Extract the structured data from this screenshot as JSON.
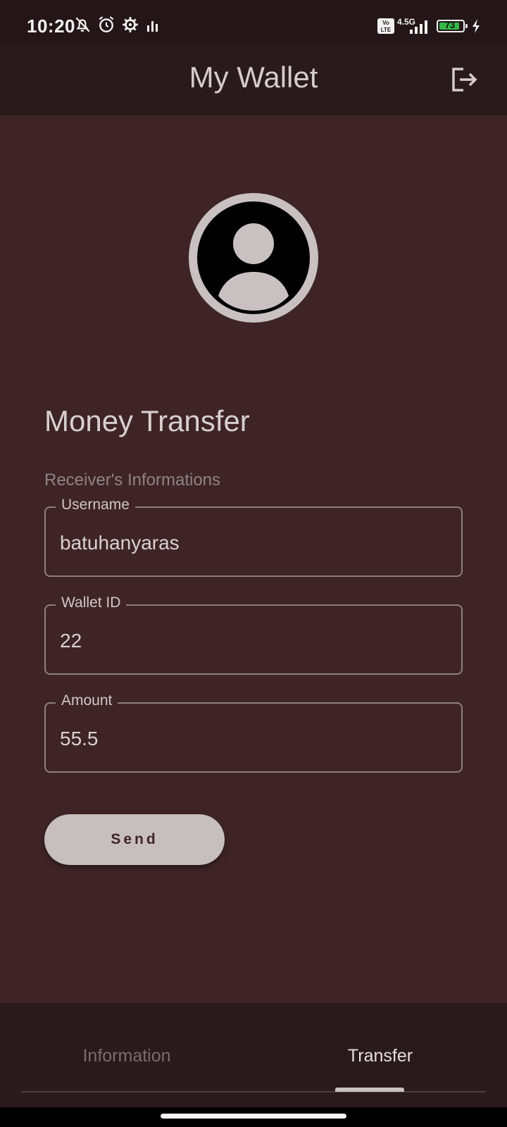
{
  "status_bar": {
    "time": "10:20",
    "icons": [
      "bell-off-icon",
      "alarm-icon",
      "gear-icon",
      "bars-icon",
      "volte-icon",
      "signal-icon",
      "battery-icon",
      "charging-icon"
    ],
    "network": "4.5G",
    "battery_percent": "73",
    "battery_color": "#35b84a"
  },
  "app_bar": {
    "title": "My Wallet",
    "action_icon": "logout-icon"
  },
  "avatar": {
    "icon": "person-icon"
  },
  "form": {
    "title": "Money Transfer",
    "subtitle": "Receiver's Informations",
    "fields": [
      {
        "label": "Username",
        "value": "batuhanyaras"
      },
      {
        "label": "Wallet ID",
        "value": "22"
      },
      {
        "label": "Amount",
        "value": "55.5"
      }
    ],
    "send_label": "Send"
  },
  "bottom_nav": {
    "tabs": [
      {
        "label": "Information",
        "active": false
      },
      {
        "label": "Transfer",
        "active": true
      }
    ]
  },
  "colors": {
    "background": "#3e2427",
    "app_bar": "#2a1a1c",
    "accent": "#c9c1c1"
  }
}
